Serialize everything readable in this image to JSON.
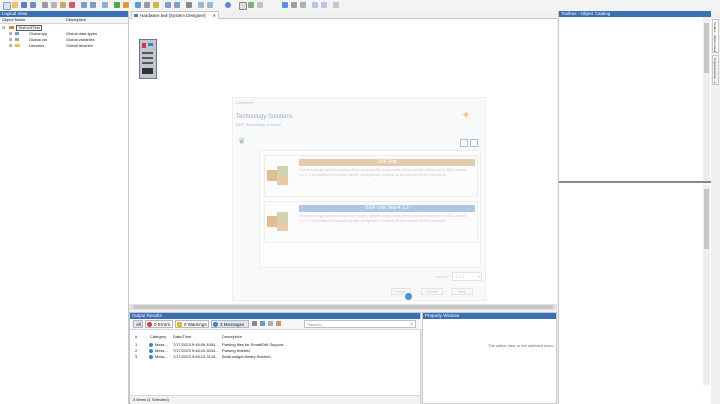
{
  "toolbar": {
    "icons": [
      "new-icon",
      "open-icon",
      "save-icon",
      "save-all-icon",
      "cut-icon",
      "copy-icon",
      "paste-icon",
      "delete-icon",
      "undo-icon",
      "redo-icon",
      "find-icon",
      "build-icon",
      "transfer-icon",
      "online-icon",
      "monitor-icon",
      "debug-icon",
      "zoom-icon",
      "settings-icon",
      "help-icon"
    ]
  },
  "logical_view": {
    "title": "Logical View",
    "columns": {
      "name": "Object Name",
      "description": "Description"
    },
    "items": [
      {
        "name": "TestUnitTest",
        "description": ""
      },
      {
        "name": "Global.typ",
        "description": "Global data types"
      },
      {
        "name": "Global.var",
        "description": "Global variables"
      },
      {
        "name": "Libraries",
        "description": "Global libraries"
      }
    ]
  },
  "editor": {
    "tab_label": "Hardware.hwl [System Designer]"
  },
  "dialog": {
    "header": "Extension",
    "title": "Technology Solutions",
    "subtitle": "B&R Technology Solution",
    "cards": [
      {
        "title": "Unit Test",
        "text": "This technology solution contains the project specific components of the unit test framework for B2C version 4.1.0. The provided executable sample configuration contains all the samples of the framework."
      },
      {
        "title": "B&R Unit Test 4.1.2",
        "text": "This technology solution contains the project specific components of the unit test framework for B2C version 4.1.0. The provided executable sample configuration contains all the samples of the framework."
      }
    ],
    "version_label": "Version:",
    "version_value": "4.1.0",
    "buttons": {
      "finish": "Finish",
      "cancel": "Cancel",
      "help": "Help"
    }
  },
  "output_results": {
    "title": "Output Results",
    "filters": {
      "all": "All",
      "errors": "0 Errors",
      "warnings": "0 Warnings",
      "messages": "3 Messages"
    },
    "search_placeholder": "Search...",
    "columns": {
      "num": "#",
      "category": "Category",
      "datetime": "Date/Time",
      "description": "Description"
    },
    "rows": [
      {
        "num": "1",
        "category": "Mess...",
        "datetime": "7/17/2023 9:48:09.4054...",
        "description": "Parsing files for SmartEdit Support..."
      },
      {
        "num": "2",
        "category": "Mess...",
        "datetime": "7/17/2023 9:48:10.3034...",
        "description": "Parsing finished"
      },
      {
        "num": "3",
        "category": "Mess...",
        "datetime": "7/17/2023 9:48:10.3143...",
        "description": "Build widget library finished."
      }
    ],
    "status": "3 Items (1 Selected)"
  },
  "property_window": {
    "title": "Property Window",
    "message": "The active view or the selected docu..."
  },
  "toolbox": {
    "title": "Toolbox - Object Catalog",
    "side_tabs": [
      "Toolbox - Object Catalog",
      "Project Explorer - Logical"
    ]
  }
}
